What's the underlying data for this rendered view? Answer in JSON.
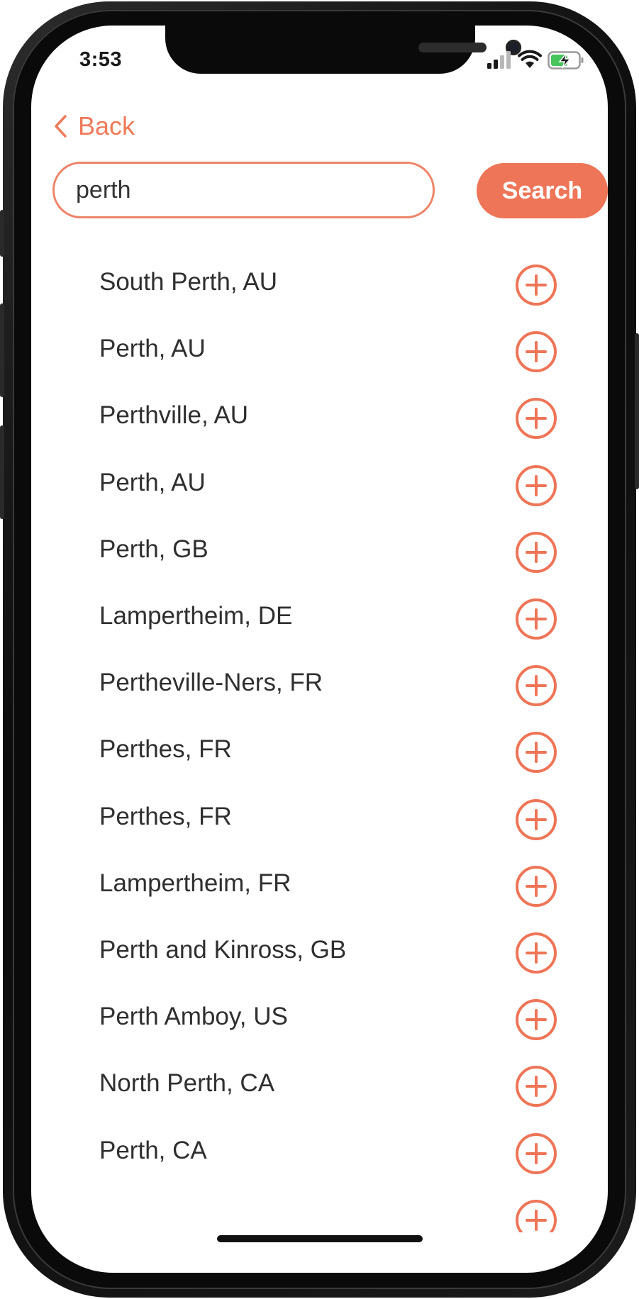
{
  "status": {
    "time": "3:53"
  },
  "nav": {
    "back_label": "Back"
  },
  "search": {
    "value": "perth",
    "button_label": "Search"
  },
  "accent_color": "#ee7557",
  "results": [
    "South Perth, AU",
    "Perth, AU",
    "Perthville, AU",
    "Perth, AU",
    "Perth, GB",
    "Lampertheim, DE",
    "Pertheville-Ners, FR",
    "Perthes, FR",
    "Perthes, FR",
    "Lampertheim, FR",
    "Perth and Kinross, GB",
    "Perth Amboy, US",
    "North Perth, CA",
    "Perth, CA"
  ],
  "icons": {
    "back": "chevron-left-icon",
    "add": "plus-circle-icon",
    "signal": "cellular-signal-icon",
    "wifi": "wifi-icon",
    "battery": "battery-charging-icon"
  }
}
